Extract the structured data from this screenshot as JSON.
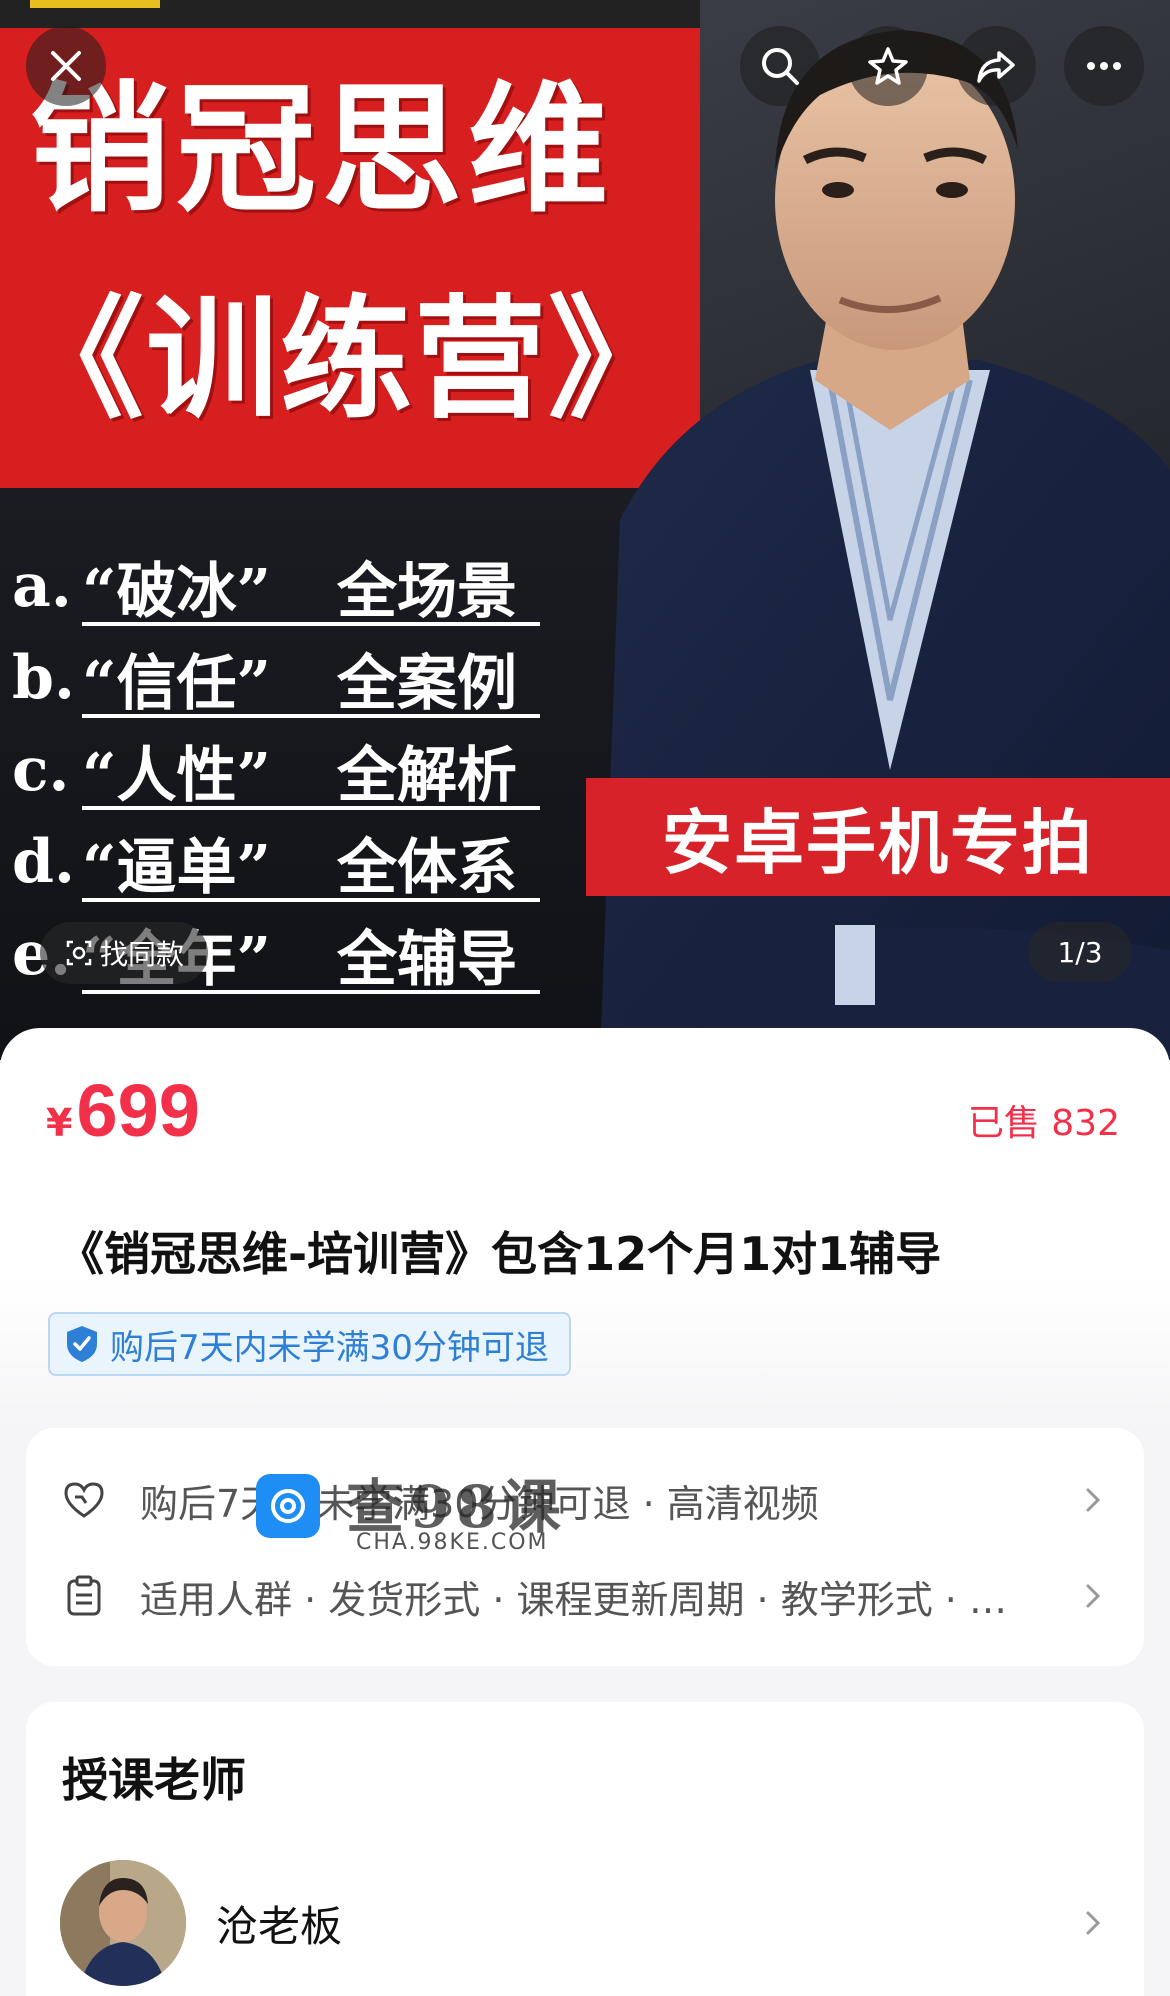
{
  "hero": {
    "title_line1": "销冠思维",
    "title_line2": "《训练营》",
    "bullets": [
      {
        "letter": "a.",
        "phrase": "“破冰”",
        "desc": "全场景"
      },
      {
        "letter": "b.",
        "phrase": "“信任”",
        "desc": "全案例"
      },
      {
        "letter": "c.",
        "phrase": "“人性”",
        "desc": "全解析"
      },
      {
        "letter": "d.",
        "phrase": "“逼单”",
        "desc": "全体系"
      },
      {
        "letter": "e.",
        "phrase": "“全年”",
        "desc": "全辅导"
      }
    ],
    "badge": "安卓手机专拍",
    "find_same_label": "找同款",
    "pager": "1/3"
  },
  "product": {
    "currency": "¥",
    "price": "699",
    "sold": "已售 832",
    "title": "《销冠思维-培训营》包含12个月1对1辅导",
    "refund_tag": "购后7天内未学满30分钟可退"
  },
  "service_card": {
    "row1": "购后7天内未学满30分钟可退 · 高清视频",
    "row2": "适用人群 · 发货形式 · 课程更新周期 · 教学形式 · …"
  },
  "watermark": {
    "text": "查98课",
    "url": "CHA.98KE.COM"
  },
  "teacher": {
    "heading": "授课老师",
    "name": "沧老板"
  }
}
